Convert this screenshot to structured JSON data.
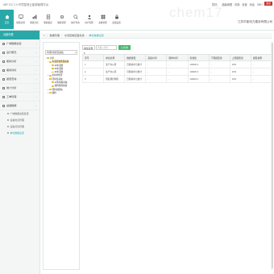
{
  "header": {
    "app_title": "#RF-EC 2.0 环境智慧云能源管理平台",
    "user_links": [
      "您好，",
      "超级管理",
      "切换",
      "设置",
      "消息",
      "290+"
    ],
    "exit_label": "退出",
    "watermark": "chem17",
    "company": "江苏华能电力建设有限公司"
  },
  "nav": {
    "items": [
      {
        "label": "首页",
        "icon": "home-icon"
      },
      {
        "label": "能耗监测",
        "icon": "monitor-icon"
      },
      {
        "label": "能效分析",
        "icon": "analysis-icon"
      },
      {
        "label": "能耗报表",
        "icon": "report-icon"
      },
      {
        "label": "能耗管理",
        "icon": "manage-icon"
      },
      {
        "label": "统计查询",
        "icon": "search-icon"
      },
      {
        "label": "用户管理",
        "icon": "user-icon"
      },
      {
        "label": "系统管理",
        "icon": "system-icon"
      },
      {
        "label": "权限设置",
        "icon": "permission-icon"
      }
    ],
    "active_index": 0
  },
  "sidebar": {
    "head": "功能列表",
    "items": [
      {
        "label": "广域数据采集"
      },
      {
        "label": "运行概况"
      },
      {
        "label": "能耗分析"
      },
      {
        "label": "能耗对标"
      },
      {
        "label": "报表查询"
      },
      {
        "label": "统计分析"
      },
      {
        "label": "工单管理"
      },
      {
        "label": "基础数据"
      }
    ],
    "subitems": [
      {
        "label": "广域数据采集装置"
      },
      {
        "label": "设备信息管理"
      },
      {
        "label": "设备点位管理"
      },
      {
        "label": "单位数据设置"
      }
    ],
    "active_sub_index": 3
  },
  "breadcrumb": {
    "items": [
      "数据管理",
      "水泥控制区面系统",
      "单位数据设置"
    ]
  },
  "tree": {
    "search_value": "华能控制区面系统",
    "nodes": [
      {
        "label": "全部",
        "level": 0,
        "toggle": "−"
      },
      {
        "label": "水泥控制区面系统",
        "level": 1,
        "toggle": "−",
        "selected": true
      },
      {
        "label": "1#水泥磨",
        "level": 2,
        "toggle": ""
      },
      {
        "label": "2#水泥磨",
        "level": 2,
        "toggle": ""
      },
      {
        "label": "3#水泥磨",
        "level": 2,
        "toggle": ""
      },
      {
        "label": "生料均化区",
        "level": 1,
        "toggle": "+"
      },
      {
        "label": "回转窑系统",
        "level": 1,
        "toggle": "−"
      },
      {
        "label": "1#生料磨系统",
        "level": 2,
        "toggle": ""
      },
      {
        "label": "熟料烧成系统",
        "level": 2,
        "toggle": ""
      },
      {
        "label": "原料调配站",
        "level": 1,
        "toggle": "+"
      },
      {
        "label": "辅料",
        "level": 1,
        "toggle": "+"
      }
    ]
  },
  "toolbar": {
    "select_value": "单位名称",
    "input_placeholder": "请输入查询",
    "search_label": "Q 查询"
  },
  "table": {
    "columns": [
      "序号",
      "单位名称",
      "数据类型",
      "采集时间",
      "取样时间",
      "标准值",
      "下限报警值",
      "上限报警值",
      "报警说明"
    ],
    "rows": [
      [
        "1",
        "生产办公区",
        "日能耗单元统计",
        "-",
        "-",
        "100kW·h",
        "-",
        "10%",
        "-"
      ],
      [
        "2",
        "生产办公区",
        "日能耗单元统计",
        "-",
        "-",
        "100kW·h",
        "-",
        "10%",
        "-"
      ],
      [
        "3",
        "预处理控制区",
        "日能耗单元统计",
        "-",
        "-",
        "100kW·h",
        "-",
        "10%",
        "-"
      ]
    ]
  },
  "colors": {
    "accent": "#2aa8a8",
    "search_button": "#46b96c",
    "exit_button": "#c9302c"
  }
}
